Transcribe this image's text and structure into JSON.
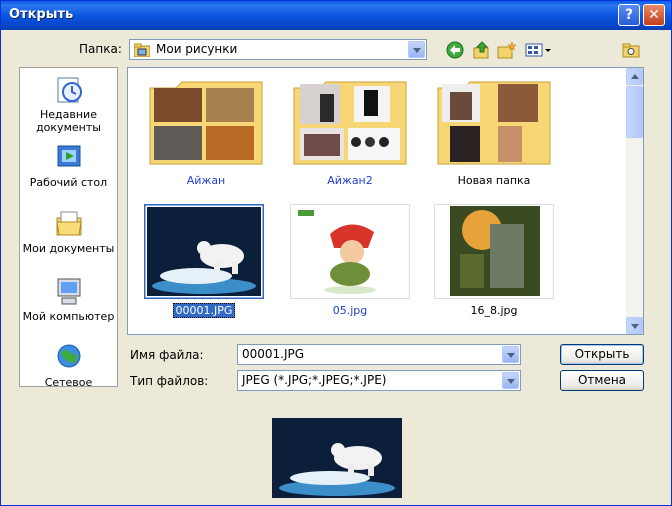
{
  "window": {
    "title": "Открыть",
    "help_label": "?",
    "close_label": "✕"
  },
  "lookin": {
    "label": "Папка:",
    "value": "Мои рисунки"
  },
  "toolbar": {
    "icons": [
      "back-icon",
      "up-folder-icon",
      "new-folder-icon",
      "view-menu-icon",
      "tools-icon"
    ]
  },
  "places": [
    {
      "label": "Недавние документы",
      "icon": "recent-documents-icon"
    },
    {
      "label": "Рабочий стол",
      "icon": "desktop-icon"
    },
    {
      "label": "Мои документы",
      "icon": "my-documents-icon"
    },
    {
      "label": "Мой компьютер",
      "icon": "my-computer-icon"
    },
    {
      "label": "Сетевое",
      "icon": "network-icon"
    }
  ],
  "files": [
    {
      "name": "Айжан",
      "kind": "folder"
    },
    {
      "name": "Айжан2",
      "kind": "folder"
    },
    {
      "name": "Новая папка",
      "kind": "folder"
    },
    {
      "name": "00001.JPG",
      "kind": "image",
      "selected": true
    },
    {
      "name": "05.jpg",
      "kind": "image"
    },
    {
      "name": "16_8.jpg",
      "kind": "image"
    }
  ],
  "filename": {
    "label": "Имя файла:",
    "value": "00001.JPG"
  },
  "filetype": {
    "label": "Тип файлов:",
    "value": "JPEG (*.JPG;*.JPEG;*.JPE)"
  },
  "buttons": {
    "open": "Открыть",
    "cancel": "Отмена"
  },
  "colors": {
    "title_bar": "#0A5BE8",
    "selection": "#316AC5",
    "folder_link": "#1F3FD0"
  }
}
